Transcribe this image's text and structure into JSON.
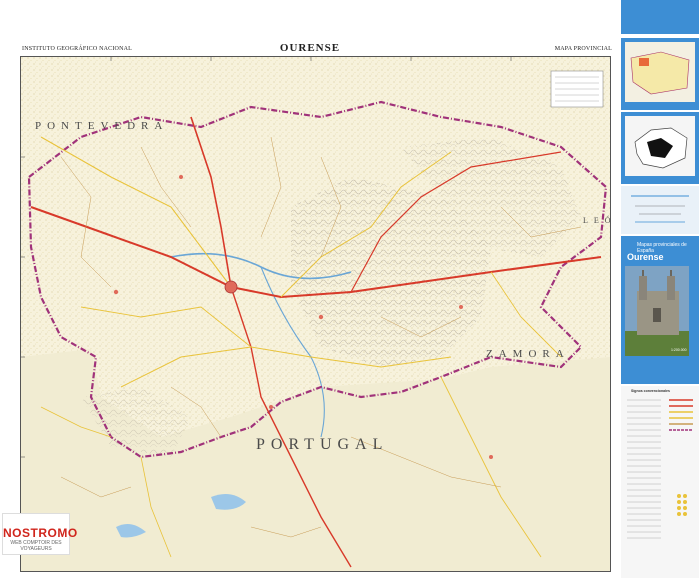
{
  "header": {
    "publisher": "INSTITUTO GEOGRÁFICO NACIONAL",
    "title": "OURENSE",
    "series": "MAPA PROVINCIAL"
  },
  "map": {
    "region_labels": {
      "pontevedra": "PONTEVEDRA",
      "zamora": "ZAMORA",
      "portugal": "PORTUGAL",
      "leon": "LEÓN"
    },
    "colors": {
      "background": "#f7f2dc",
      "relief": "#c9c2b5",
      "province_border": "#a0327a",
      "road_main": "#d83a2a",
      "road_secondary": "#e9c33a",
      "water": "#9cc7e8",
      "outside_area": "#f4efd8"
    }
  },
  "cover": {
    "series_title": "Mapas provinciales de España",
    "province_name": "Ourense",
    "scale": "1:200.000",
    "legend_title": "Signos convencionales",
    "colors": {
      "panel_blue": "#3d8ed4",
      "panel_light": "#e9f1f8"
    }
  },
  "branding": {
    "logo_name": "NOSTROMO",
    "logo_tagline": "WEB COMPTOIR DES VOYAGEURS"
  }
}
